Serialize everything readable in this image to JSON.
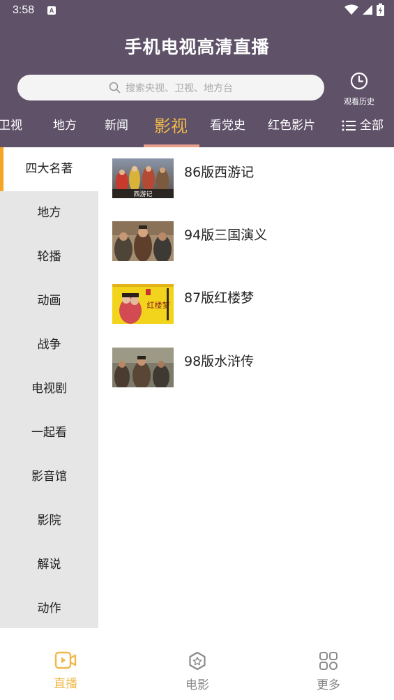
{
  "status_bar": {
    "time": "3:58",
    "notification_letter": "A"
  },
  "header": {
    "app_title": "手机电视高清直播",
    "search_placeholder": "搜索央视、卫视、地方台",
    "history_label": "观看历史"
  },
  "tabs": [
    {
      "label": "卫视"
    },
    {
      "label": "地方"
    },
    {
      "label": "新闻"
    },
    {
      "label": "影视",
      "active": true
    },
    {
      "label": "看党史"
    },
    {
      "label": "红色影片"
    }
  ],
  "tab_all_label": "全部",
  "sidebar": [
    {
      "label": "四大名著",
      "active": true
    },
    {
      "label": "地方"
    },
    {
      "label": "轮播"
    },
    {
      "label": "动画"
    },
    {
      "label": "战争"
    },
    {
      "label": "电视剧"
    },
    {
      "label": "一起看"
    },
    {
      "label": "影音馆"
    },
    {
      "label": "影院"
    },
    {
      "label": "解说"
    },
    {
      "label": "动作"
    }
  ],
  "content_items": [
    {
      "title": "86版西游记",
      "thumb_text": "西游记"
    },
    {
      "title": "94版三国演义"
    },
    {
      "title": "87版红楼梦",
      "thumb_text": "红楼梦"
    },
    {
      "title": "98版水浒传"
    }
  ],
  "bottom_nav": [
    {
      "label": "直播",
      "icon": "live-video-icon",
      "active": true
    },
    {
      "label": "电影",
      "icon": "movie-badge-icon"
    },
    {
      "label": "更多",
      "icon": "apps-grid-icon"
    }
  ],
  "colors": {
    "header_bg": "#5e5168",
    "accent": "#f0b84b",
    "sidebar_marker": "#f6a623",
    "tab_underline": "#e9a08a",
    "sidebar_bg": "#e6e6e6",
    "nav_inactive": "#8a8a8a"
  }
}
